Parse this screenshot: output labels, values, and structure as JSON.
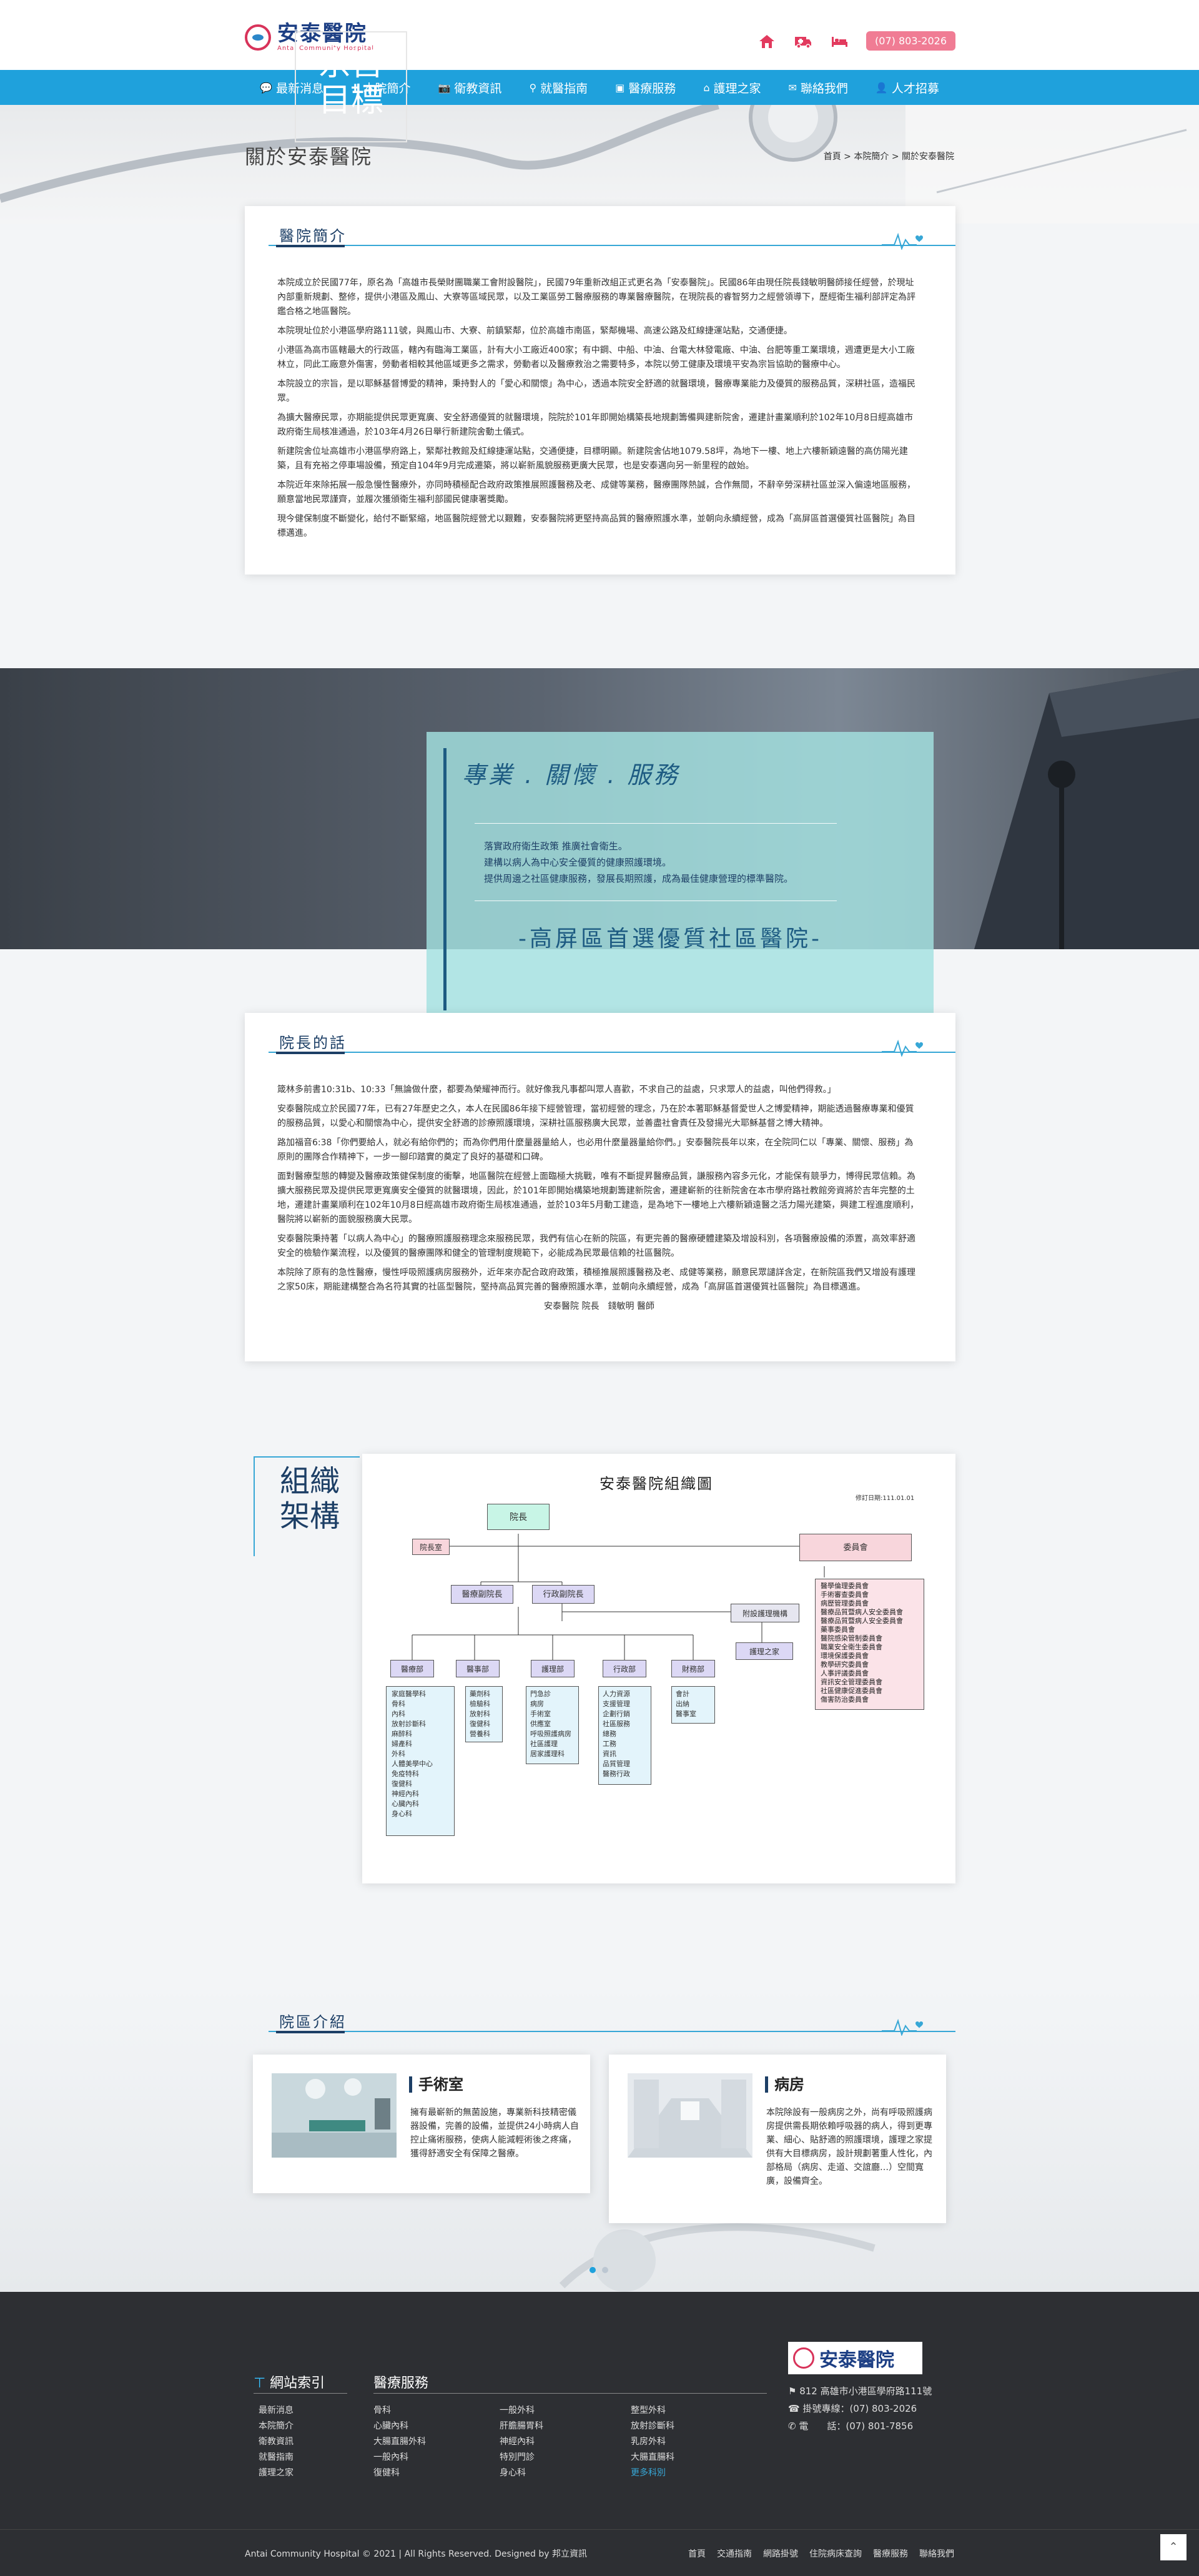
{
  "header": {
    "logo_cn": "安泰醫院",
    "logo_en": "Antai Community Hospital",
    "phone_label": "(07) 803-2026",
    "icons": [
      "home-icon",
      "ambulance-icon",
      "bed-icon"
    ]
  },
  "nav": {
    "items": [
      {
        "label": "最新消息",
        "icon": "chat-icon"
      },
      {
        "label": "本院簡介",
        "icon": "plus-icon"
      },
      {
        "label": "衛教資訊",
        "icon": "camera-icon"
      },
      {
        "label": "就醫指南",
        "icon": "map-pin-icon"
      },
      {
        "label": "醫療服務",
        "icon": "doctor-icon"
      },
      {
        "label": "護理之家",
        "icon": "home-icon"
      },
      {
        "label": "聯絡我們",
        "icon": "mail-icon"
      },
      {
        "label": "人才招募",
        "icon": "user-add-icon"
      }
    ]
  },
  "hero": {
    "title": "關於安泰醫院",
    "breadcrumb": "首頁 > 本院簡介 > 關於安泰醫院"
  },
  "intro": {
    "title": "醫院簡介",
    "paragraphs": [
      "本院成立於民國77年，原名為「高雄市長榮財團職業工會附設醫院」，民國79年重新改組正式更名為「安泰醫院」。民國86年由現任院長錢敏明醫師接任經營，於現址內部重新規劃、整修，提供小港區及鳳山、大寮等區域民眾，以及工業區勞工醫療服務的專業醫療醫院，在現院長的睿智努力之經營領導下，歷經衛生福利部評定為評鑑合格之地區醫院。",
      "本院現址位於小港區學府路111號，與鳳山市、大寮、前鎮緊鄰，位於高雄市南區，緊鄰機場、高速公路及紅線捷運站點，交通便捷。",
      "小港區為高市區轄最大的行政區，轄內有臨海工業區，計有大小工廠近400家；有中鋼、中船、中油、台電大林發電廠、中油、台肥等重工業環境，週遭更是大小工廠林立，同此工廠意外傷害，勞動者相較其他區域更多之需求，勞動者以及醫療救治之需要特多，本院以勞工健康及環境平安為宗旨協助的醫療中心。",
      "本院設立的宗旨，是以耶穌基督博愛的精神，秉持對人的「愛心和關懷」為中心，透過本院安全舒適的就醫環境，醫療專業能力及優質的服務品質，深耕社區，造福民眾。",
      "為擴大醫療民眾，亦期能提供民眾更寬廣、安全舒適優質的就醫環境，院院於101年即開始構築長地規劃籌備興建新院舍，遷建計畫業順利於102年10月8日經高雄市政府衛生局核准通過，於103年4月26日舉行新建院舍動土儀式。",
      "新建院舍位址高雄市小港區學府路上，緊鄰社教館及紅線捷運站點，交通便捷，目標明顯。新建院舍佔地1079.58坪，為地下一樓、地上六樓新穎遠醫的高仿陽光建築，且有充裕之停車場設備，預定自104年9月完成遷築，將以嶄新風貌服務更廣大民眾，也是安泰邁向另一新里程的啟始。",
      "本院近年來除拓展一般急慢性醫療外，亦同時積極配合政府政策推展照護醫務及老、成健等業務，醫療團隊熱誠，合作無間，不辭辛勞深耕社區並深入偏遠地區服務，願意當地民眾謹齊，並履次獲頒衛生福利部國民健康署獎勵。",
      "現今健保制度不斷變化，給付不斷緊縮，地區醫院經營尤以艱難，安泰醫院將更堅持高品質的醫療照護水準，並朝向永續經營，成為「高屏區首選優質社區醫院」為目標邁進。"
    ]
  },
  "mission": {
    "label_line1": "宗旨",
    "label_line2": "目標",
    "slogan": "專業 . 關懷 . 服務",
    "lines": [
      "落實政府衛生政策 推廣社會衛生。",
      "建構以病人為中心安全優質的健康照護環境。",
      "提供周邊之社區健康服務，發展長期照護，成為最佳健康營理的標準醫院。"
    ],
    "goal": "-高屏區首選優質社區醫院-"
  },
  "director": {
    "title": "院長的話",
    "paragraphs": [
      "箴林多前書10:31b、10:33「無論做什麼，都要為榮耀神而行。就好像我凡事都叫眾人喜歡，不求自己的益處，只求眾人的益處，叫他們得救。」",
      "安泰醫院成立於民國77年，已有27年歷史之久，本人在民國86年接下經營管理，當初經營的理念，乃在於本著耶穌基督愛世人之博愛精神，期能透過醫療專業和優質的服務品質，以愛心和關懷為中心，提供安全舒適的診療照護環境，深耕社區服務廣大民眾，並善盡社會責任及發揚光大耶穌基督之博大精神。",
      "路加福音6:38「你們要給人，就必有給你們的；而為你們用什麼量器量給人，也必用什麼量器量給你們。」安泰醫院長年以來，在全院同仁以「專業、關懷、服務」為原則的團隊合作精神下，一步一腳印踏實的奠定了良好的基礎和口碑。",
      "面對醫療型態的轉變及醫療政策健保制度的衝擊，地區醫院在經營上面臨極大挑戰，唯有不斷提昇醫療品質，謙服務內容多元化，才能保有競爭力，博得民眾信賴。為擴大服務民眾及提供民眾更寬廣安全優質的就醫環境，因此，於101年即開始構築地規劃籌建新院舍，遷建嶄新的往新院舍在本市學府路社教館旁資將於吉年完整的土地，遷建計畫業順利在102年10月8日經高雄市政府衛生局核准通過，並於103年5月動工建造，是為地下一樓地上六樓新穎遠醫之活力陽光建築，興建工程進度順利，醫院將以嶄新的面貌服務廣大民眾。",
      "安泰醫院秉持著「以病人為中心」的醫療照護服務理念來服務民眾，我們有信心在新的院區，有更完善的醫療硬體建築及增設科別，各項醫療設備的添置，高效率舒適安全的檢驗作業流程，以及優質的醫療團隊和健全的管理制度規範下，必能成為民眾最信賴的社區醫院。",
      "本院除了原有的急性醫療，慢性呼吸照護病房服務外，近年來亦配合政府政策，積極推展照護醫務及老、成健等業務，願意民眾譴詳含定，在新院區我們又增設有護理之家50床，期能建構整合為名符其實的社區型醫院，堅持高品質完善的醫療照護水準，並朝向永續經營，成為「高屏區首選優質社區醫院」為目標邁進。"
    ],
    "signature": "安泰醫院 院長　錢敏明 醫師"
  },
  "org": {
    "label_line1": "組織",
    "label_line2": "架構",
    "chart_title": "安泰醫院組織圖",
    "version": "修訂日期:111.01.01",
    "nodes": {
      "president": "院長",
      "secretary": "院長室",
      "board": "委員會",
      "vp_medical": "醫療副院長",
      "vp_admin": "行政副院長",
      "nursing_home": "附設護理機構",
      "nursing_home2": "護理之家",
      "depts": [
        "醫療部",
        "醫事部",
        "護理部",
        "行政部",
        "財務部"
      ],
      "committees": [
        "醫學倫理委員會",
        "手術審查委員會",
        "病歷管理委員會",
        "醫療品質暨病人安全委員會",
        "醫療品質暨病人安全委員會",
        "藥事委員會",
        "醫院感染管制委員會",
        "職業安全衛生委員會",
        "環境保護委員會",
        "教學研究委員會",
        "人事評議委員會",
        "資訊安全管理委員會",
        "社區健康促進委員會",
        "傷害防治委員會",
        "急救作業委員會"
      ],
      "medical_items": [
        "家庭醫學科",
        "骨科",
        "內科",
        "放射診斷科",
        "麻醉科",
        "婦產科",
        "外科",
        "人體美學中心",
        "免疫特科",
        "復健科",
        "神經內科",
        "心臟內科",
        "身心科"
      ],
      "medtech_items": [
        "藥劑科",
        "檢驗科",
        "放射科",
        "復健科",
        "營養科"
      ],
      "nursing_items": [
        "門急診",
        "病房",
        "手術室",
        "供應室",
        "呼吸照護病房",
        "社區護理",
        "居家護理科"
      ],
      "admin_items": [
        "人力資源",
        "支援管理",
        "企劃行銷",
        "社區服務",
        "總務",
        "工務",
        "資訊",
        "品質管理",
        "醫務行政"
      ],
      "finance_items": [
        "會計",
        "出納",
        "醫事室"
      ]
    }
  },
  "areas": {
    "title": "院區介紹",
    "items": [
      {
        "title": "手術室",
        "text": "擁有最嶄新的無菌設施，專業新科技精密儀器設備，完善的設備，並提供24小時病人自控止痛術服務，使病人能減輕術後之疼痛，獲得舒適安全有保障之醫療。"
      },
      {
        "title": "病房",
        "text": "本院除設有一般病房之外，尚有呼吸照護病房提供需長期依賴呼吸器的病人，得到更專業、細心、貼舒適的照護環境，護理之家提供有大目標病房，設計規劃著重人性化，內部格局（病房、走道、交誼廳…）空間寬廣，設備齊全。"
      }
    ],
    "dots": 2
  },
  "footer": {
    "sitemap_title": "網站索引",
    "sitemap": [
      "最新消息",
      "本院簡介",
      "衛教資訊",
      "就醫指南",
      "護理之家"
    ],
    "services_title": "醫療服務",
    "services_col1": [
      "骨科",
      "心臟內科",
      "大腸直腸外科",
      "一般內科",
      "復健科"
    ],
    "services_col2": [
      "一般外科",
      "肝膽腸胃科",
      "神經內科",
      "特別門診",
      "身心科"
    ],
    "services_col3": [
      "整型外科",
      "放射診斷科",
      "乳房外科",
      "大腸直腸科",
      "更多科別"
    ],
    "logo_cn": "安泰醫院",
    "address": "812 高雄市小港區學府路111號",
    "reg_phone": "掛號專線：(07) 803-2026",
    "tel": "電　　話：(07) 801-7856",
    "copyright": "Antai Community Hospital © 2021 | All Rights Reserved. Designed by 邦立資訊",
    "links": [
      "首頁",
      "交通指南",
      "網路掛號",
      "住院病床查詢",
      "醫療服務",
      "聯絡我們"
    ]
  }
}
